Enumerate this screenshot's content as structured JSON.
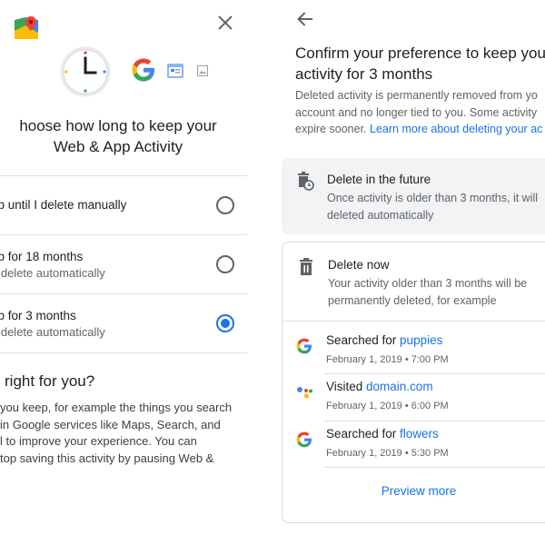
{
  "left_panel": {
    "title_line1": "hoose how long to keep your",
    "title_line2": "Web & App Activity",
    "options": [
      {
        "label": "ep until I delete manually",
        "sub": "",
        "selected": false
      },
      {
        "label": "ep for 18 months",
        "sub": "n delete automatically",
        "selected": false
      },
      {
        "label": "ep for 3 months",
        "sub": "n delete automatically",
        "selected": true
      }
    ],
    "section_heading": "is right for you?",
    "body_lines": [
      "you keep, for example the things you search",
      "in Google services like Maps, Search, and",
      "l to improve your experience. You can",
      "top saving this activity by pausing Web &"
    ],
    "icons": [
      "close-icon",
      "maps-icon",
      "clock-icon",
      "google-icon",
      "google-sites-icon",
      "image-icon"
    ]
  },
  "right_panel": {
    "title_line1": "Confirm your preference to keep you",
    "title_line2": "activity for 3 months",
    "desc_line1": "Deleted activity is permanently removed from yo",
    "desc_line2": "account and no longer tied to you. Some activity",
    "desc_line3_prefix": "expire sooner. ",
    "desc_link": "Learn more about deleting your ac",
    "future_card": {
      "title": "Delete in the future",
      "sub_line1": "Once activity is older than 3 months, it will",
      "sub_line2": "deleted automatically"
    },
    "now_card": {
      "title": "Delete now",
      "sub_line1": "Your activity older than 3 months will be",
      "sub_line2": "permanently deleted, for example"
    },
    "history": [
      {
        "icon": "google-icon",
        "action": "Searched for ",
        "target": "puppies",
        "time": "February 1, 2019 • 7:00 PM"
      },
      {
        "icon": "assistant-icon",
        "action": "Visited ",
        "target": "domain.com",
        "time": "February 1, 2019 • 6:00 PM"
      },
      {
        "icon": "google-icon",
        "action": "Searched for ",
        "target": "flowers",
        "time": "February 1, 2019 • 5:30 PM"
      }
    ],
    "preview_more": "Preview more"
  },
  "colors": {
    "accent": "#1a73e8",
    "text_primary": "#202124",
    "text_secondary": "#5f6368",
    "card_bg": "#f1f3f4"
  }
}
